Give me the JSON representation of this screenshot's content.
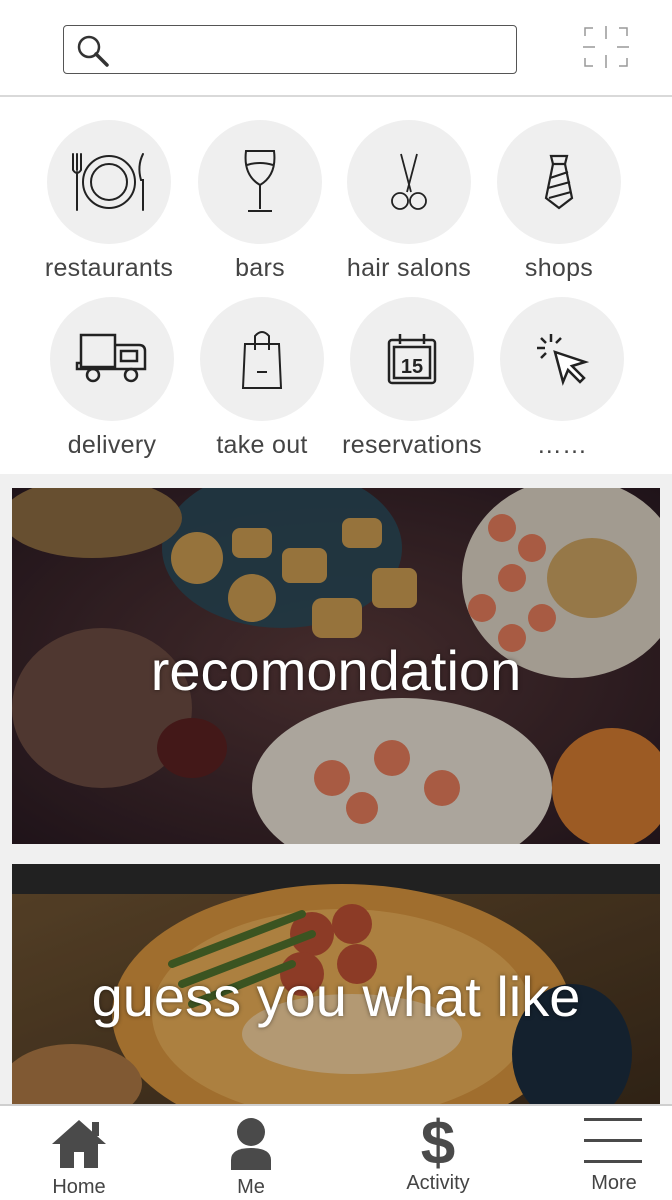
{
  "search": {
    "placeholder": "",
    "value": ""
  },
  "categories": [
    {
      "label": "restaurants",
      "icon": "restaurant-icon"
    },
    {
      "label": "bars",
      "icon": "wine-glass-icon"
    },
    {
      "label": "hair salons",
      "icon": "scissors-icon"
    },
    {
      "label": "shops",
      "icon": "tie-icon"
    },
    {
      "label": "delivery",
      "icon": "truck-icon"
    },
    {
      "label": "take out",
      "icon": "shopping-bag-icon"
    },
    {
      "label": "reservations",
      "icon": "calendar-icon"
    },
    {
      "label": "……",
      "icon": "cursor-click-icon"
    }
  ],
  "calendar_day": "15",
  "banners": [
    {
      "title": "recomondation"
    },
    {
      "title": "guess you what like"
    }
  ],
  "nav": {
    "home": "Home",
    "me": "Me",
    "activity": "Activity",
    "more": "More"
  },
  "colors": {
    "circle_bg": "#efefef",
    "icon_stroke": "#222222",
    "nav_icon": "#4a4a4a",
    "divider": "#d9d9d9"
  }
}
